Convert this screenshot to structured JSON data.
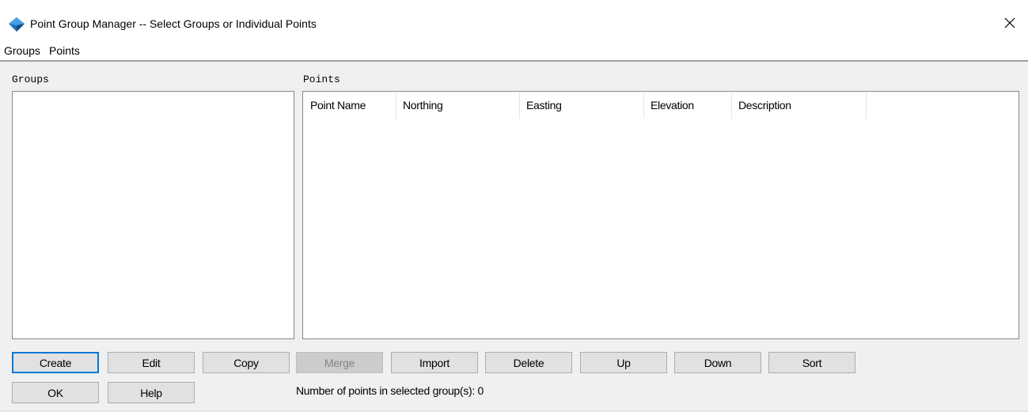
{
  "window": {
    "title": "Point Group Manager -- Select Groups or Individual Points",
    "accent_color": "#1e73be"
  },
  "menu": {
    "items": [
      {
        "label": "Groups"
      },
      {
        "label": "Points"
      }
    ]
  },
  "groups_panel": {
    "label": "Groups"
  },
  "points_panel": {
    "label": "Points",
    "columns": [
      "Point Name",
      "Northing",
      "Easting",
      "Elevation",
      "Description"
    ]
  },
  "buttons": {
    "create": "Create",
    "edit": "Edit",
    "copy": "Copy",
    "merge": "Merge",
    "import": "Import",
    "delete": "Delete",
    "up": "Up",
    "down": "Down",
    "sort": "Sort",
    "ok": "OK",
    "help": "Help"
  },
  "status": {
    "text": "Number of points in selected group(s):  0"
  },
  "icons": {
    "app": "autocad-civil-app-icon",
    "close": "close-icon"
  }
}
